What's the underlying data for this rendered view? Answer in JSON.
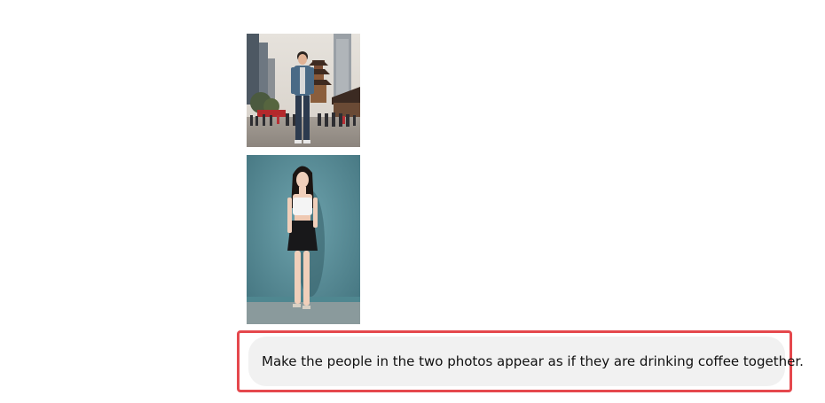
{
  "chat": {
    "attachments": [
      {
        "kind": "image",
        "subject": "man-standing-in-city-square"
      },
      {
        "kind": "image",
        "subject": "woman-posing-by-teal-wall"
      }
    ],
    "message": {
      "text": "Make the people in the two photos appear as if they are drinking coffee together."
    }
  },
  "colors": {
    "background": "#ffffff",
    "bubble": "#f1f1f1",
    "highlight": "#e5484d",
    "text": "#111111"
  }
}
